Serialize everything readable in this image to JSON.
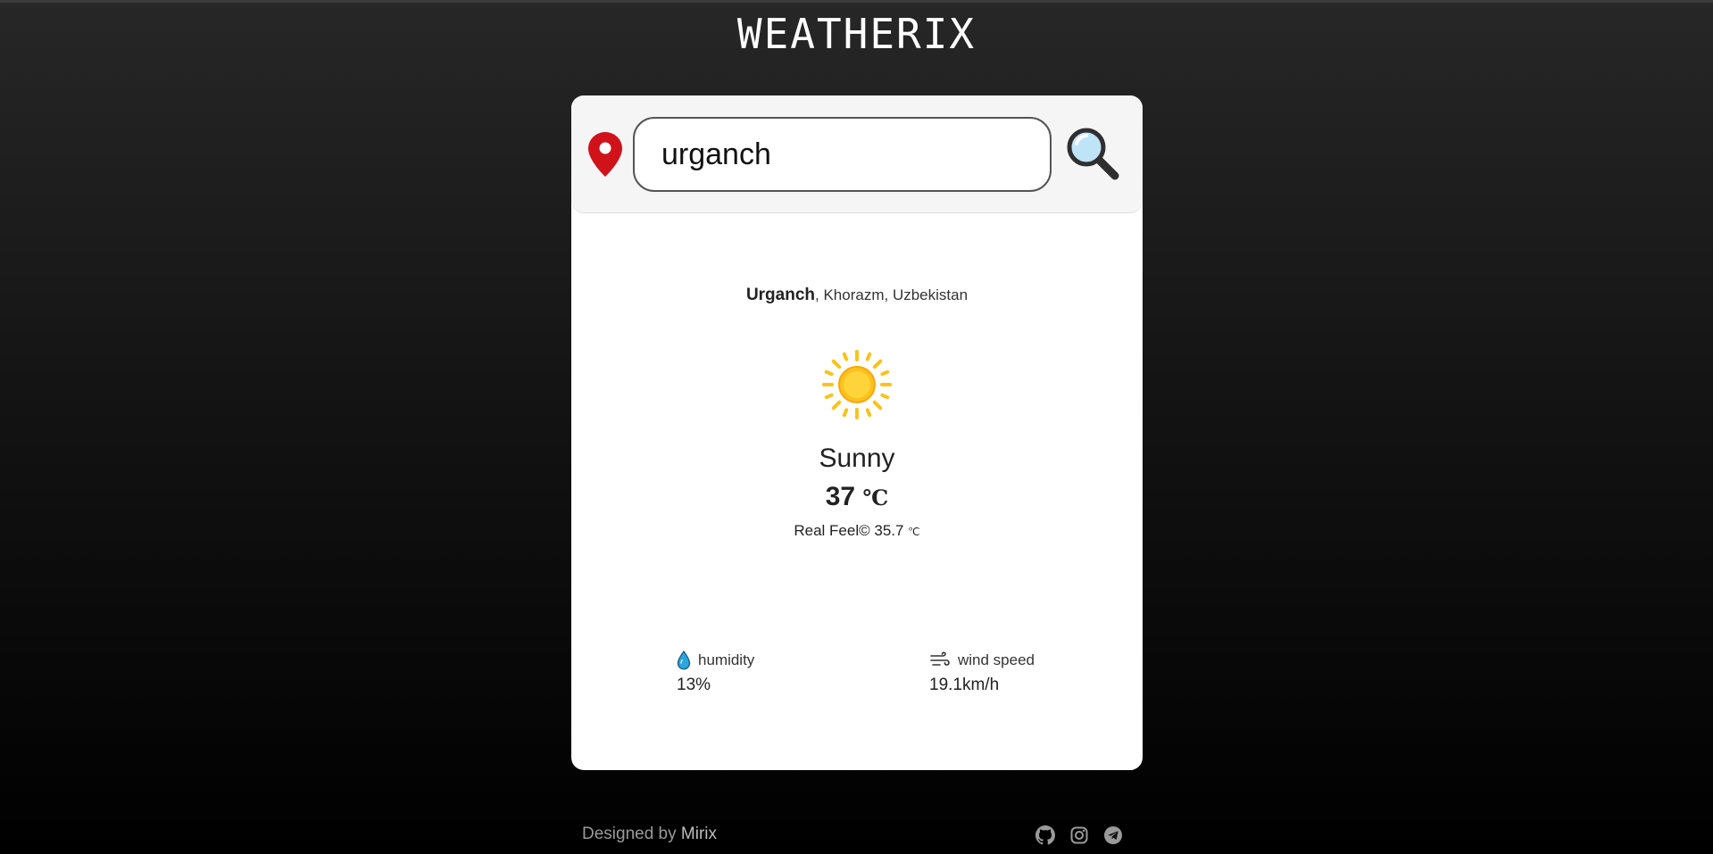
{
  "app": {
    "title": "WEATHERIX"
  },
  "search": {
    "value": "urganch",
    "placeholder": ""
  },
  "location": {
    "city": "Urganch",
    "region": ", Khorazm, ",
    "country": "Uzbekistan"
  },
  "weather": {
    "condition": "Sunny",
    "icon": "sun-icon",
    "temperature": "37",
    "temperature_unit": "℃",
    "real_feel_label": "Real Feel© ",
    "real_feel_value": "35.7 ",
    "real_feel_unit": "℃"
  },
  "stats": {
    "humidity": {
      "label": "humidity",
      "icon": "droplet-icon",
      "value": "13%"
    },
    "wind": {
      "label": "wind speed",
      "icon": "wind-icon",
      "value": "19.1km/h"
    }
  },
  "footer": {
    "credit": "Designed by ",
    "author": "Mirix",
    "social": [
      "github-icon",
      "instagram-icon",
      "telegram-icon"
    ]
  },
  "colors": {
    "pin": "#d0121b",
    "sun": "#fcc21b",
    "droplet": "#2aa6dd",
    "card": "#ffffff"
  }
}
